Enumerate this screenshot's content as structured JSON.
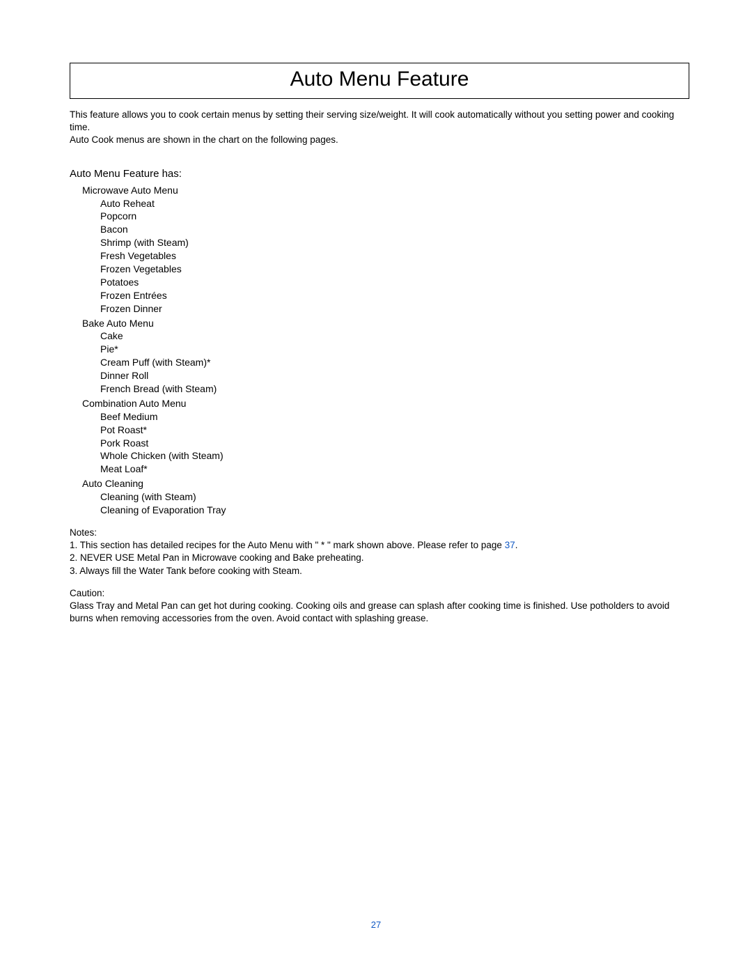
{
  "title": "Auto Menu Feature",
  "intro_p1": "This feature allows you to cook certain menus by setting their serving size/weight. It will cook automatically without you setting power and cooking time.",
  "intro_p2": "Auto Cook menus are shown in the chart on the following pages.",
  "section_heading": "Auto Menu Feature has:",
  "groups": [
    {
      "title": "Microwave Auto Menu",
      "items": [
        "Auto Reheat",
        "Popcorn",
        "Bacon",
        "Shrimp (with Steam)",
        "Fresh Vegetables",
        "Frozen Vegetables",
        "Potatoes",
        "Frozen Entrées",
        "Frozen Dinner"
      ]
    },
    {
      "title": "Bake Auto Menu",
      "items": [
        "Cake",
        "Pie*",
        "Cream Puff (with Steam)*",
        "Dinner Roll",
        "French Bread (with Steam)"
      ]
    },
    {
      "title": "Combination Auto Menu",
      "items": [
        "Beef Medium",
        "Pot Roast*",
        "Pork Roast",
        "Whole Chicken (with Steam)",
        "Meat Loaf*"
      ]
    },
    {
      "title": "Auto Cleaning",
      "items": [
        "Cleaning (with Steam)",
        "Cleaning of Evaporation Tray"
      ]
    }
  ],
  "notes_label": "Notes:",
  "notes": {
    "n1_pre": "1.  This section has detailed recipes for the Auto Menu with \" * \" mark shown above. Please refer to page ",
    "n1_link": "37",
    "n1_post": ".",
    "n2": "2.  NEVER USE Metal Pan in Microwave cooking and Bake preheating.",
    "n3": "3.  Always fill the Water Tank before cooking with Steam."
  },
  "caution_label": "Caution:",
  "caution_text": "Glass Tray and Metal Pan can get hot during cooking. Cooking oils and grease can splash after cooking time is finished. Use potholders to avoid burns when removing accessories from the oven. Avoid contact with splashing grease.",
  "page_number": "27"
}
